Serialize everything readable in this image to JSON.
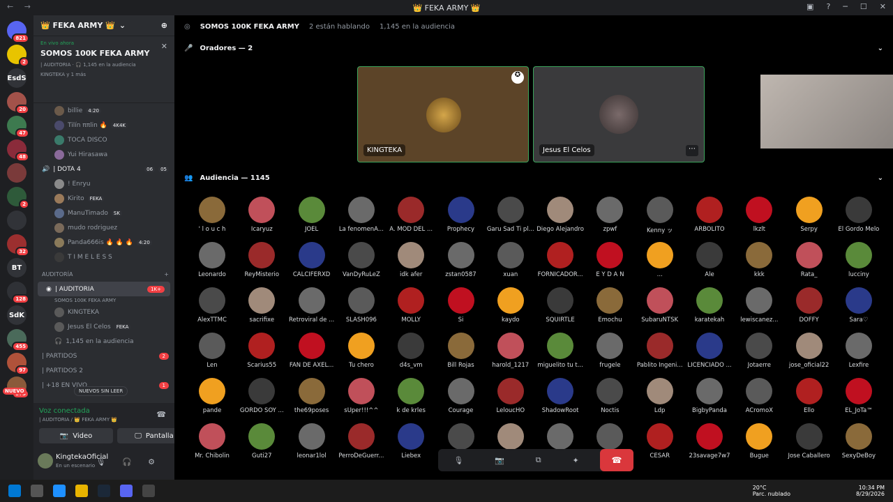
{
  "window": {
    "title": "👑 FEKA ARMY 👑"
  },
  "servers": [
    {
      "label": "",
      "badge": "821",
      "color": "#5865f2"
    },
    {
      "label": "",
      "badge": "2",
      "color": "#e8c400"
    },
    {
      "label": "EsdS",
      "badge": "",
      "color": "#313338"
    },
    {
      "label": "",
      "badge": "20",
      "color": "#a3524a"
    },
    {
      "label": "",
      "badge": "47",
      "color": "#3d7a4f"
    },
    {
      "label": "",
      "badge": "48",
      "color": "#8a2b3a"
    },
    {
      "label": "",
      "badge": "",
      "color": "#7a3a3a"
    },
    {
      "label": "",
      "badge": "2",
      "color": "#2e5a3a"
    },
    {
      "label": "",
      "badge": "",
      "color": "#313338"
    },
    {
      "label": "",
      "badge": "32",
      "color": "#9c2f2f"
    },
    {
      "label": "BT",
      "badge": "",
      "color": "#313338"
    },
    {
      "label": "",
      "badge": "128",
      "color": "#2f3136"
    },
    {
      "label": "SdK",
      "badge": "",
      "color": "#313338"
    },
    {
      "label": "",
      "badge": "455",
      "color": "#4a6a5a"
    },
    {
      "label": "",
      "badge": "97",
      "color": "#b0523a"
    },
    {
      "label": "",
      "badge": "373",
      "color": "#8a5a3a"
    }
  ],
  "new_badge": "NUEVO",
  "sidebar": {
    "server_name": "👑 FEKA ARMY 👑",
    "live_label": "En vivo ahora",
    "stage_title": "SOMOS 100K FEKA ARMY",
    "stage_sub": "| AUDITORIA · 🎧 1,145 en la audiencia",
    "stage_people": "KINGTEKA y 1 más",
    "members_top": [
      {
        "name": "billie",
        "tag": "4:20",
        "color": "#6b5a4a"
      },
      {
        "name": "Tilín ππlin 🔥",
        "tag": "4K4K",
        "color": "#4a4a6b"
      },
      {
        "name": "TOCA DISCO",
        "tag": "",
        "color": "#3a7a6a"
      },
      {
        "name": "Yui Hirasawa",
        "tag": "",
        "color": "#8a6a9a"
      }
    ],
    "dota_channel": "| DOTA 4",
    "dota_count_a": "06",
    "dota_count_b": "05",
    "dota_members": [
      {
        "name": "! Enryu",
        "tag": "",
        "color": "#8a8a8a"
      },
      {
        "name": "Kirito",
        "tag": "FEKA",
        "color": "#9a7a5a"
      },
      {
        "name": "ManuTimado",
        "tag": "SK",
        "color": "#5a6a8a"
      },
      {
        "name": "mudo rodriguez",
        "tag": "",
        "color": "#7a6a5a"
      },
      {
        "name": "Panda666is 🔥 🔥 🔥",
        "tag": "4:20",
        "color": "#8a7a5a"
      },
      {
        "name": "T I M E L E S S",
        "tag": "",
        "color": "#3a3a3a"
      }
    ],
    "category": "AUDITORÍA",
    "auditoria_channel": "| AUDITORIA",
    "auditoria_badge": "1K+",
    "auditoria_sub": "SOMOS 100K FEKA ARMY",
    "auditoria_members": [
      {
        "name": "KINGTEKA",
        "tag": ""
      },
      {
        "name": "Jesus El Celos",
        "tag": "FEKA"
      }
    ],
    "audience_line": "1,145 en la audiencia",
    "other_channels": [
      {
        "name": "| PARTIDOS",
        "badge": "2"
      },
      {
        "name": "| PARTIDOS 2",
        "badge": ""
      },
      {
        "name": "| +18 EN VIVO",
        "badge": "1"
      }
    ],
    "unread_pill": "NUEVOS SIN LEER"
  },
  "voice": {
    "status": "Voz conectada",
    "sub": "| AUDITORIA / 👑 FEKA ARMY 👑",
    "video_label": "Video",
    "screen_label": "Pantalla",
    "user_name": "KingtekaOficial",
    "user_status": "En un escenario"
  },
  "stage": {
    "title": "SOMOS 100K FEKA ARMY",
    "speaking": "2 están hablando",
    "audience": "1,145 en la audiencia",
    "speakers_header": "Oradores — 2",
    "audience_header": "Audiencia — 1145",
    "speakers": [
      {
        "name": "KINGTEKA",
        "bg": "#5c4428"
      },
      {
        "name": "Jesus El Celos",
        "bg": "#3a3a3c"
      }
    ]
  },
  "audience": [
    [
      "' l o u c h",
      "Icaryuz",
      "JOEL",
      "La fenomenA...",
      "A. MOD DEL ...",
      "Prophecy",
      "Garu Sad Ti pl...",
      "Diego Alejandro",
      "zpwf",
      "Kenny ッ",
      "ARBOLITO",
      "lkzlt",
      "Serpy",
      "El Gordo Melo"
    ],
    [
      "Leonardo",
      "ReyMisterio",
      "CALCIFERXD",
      "VanDyRuLeZ",
      "idk afer",
      "zstan0587",
      "xuan",
      "FORNICADOR...",
      "E Y D A N",
      "...",
      "Ale",
      "kkk",
      "Rata_",
      "lucciny"
    ],
    [
      "AlexTTMC",
      "sacrifixe",
      "Retroviral de ...",
      "SLASH096",
      "MOLLY",
      "Si",
      "kaydo",
      "SQUIRTLE",
      "Emochu",
      "SubaruNTSK",
      "karatekah",
      "lewiscanez...",
      "DOFFY",
      "Sara♡"
    ],
    [
      "Len",
      "Scarius55",
      "FAN DE AXEL...",
      "Tu chero",
      "d4s_vm",
      "Bill Rojas",
      "harold_1217",
      "miguelito tu t...",
      "frugele",
      "Pablito Ingeni...",
      "LICENCIADO ...",
      "Jotaerre",
      "jose_oficial22",
      "Lexfire"
    ],
    [
      "pande",
      "GORDO SOY ...",
      "the69poses",
      "sUper!!!^^",
      "k de krles",
      "Courage",
      "LeloucHO",
      "ShadowRoot",
      "Noctis",
      "Ldp",
      "BigbyPanda",
      "ACromoX",
      "Ello",
      "EL_JoTa™"
    ],
    [
      "Mr. Chibolin",
      "Guti27",
      "leonar1lol",
      "PerroDeGuerr...",
      "Liebex",
      "",
      "",
      "",
      "",
      "CESAR",
      "23savage7w7",
      "Bugue",
      "Jose Caballero",
      "SexyDeBoy"
    ]
  ],
  "avatar_colors": [
    "#8a6a3a",
    "#c0505a",
    "#5a8a3a",
    "#6a6a6a",
    "#9a2a2a",
    "#2a3a8a",
    "#4a4a4a",
    "#a08a7a",
    "#6a6a6a",
    "#5a5a5a",
    "#b02020",
    "#c01020",
    "#f0a020",
    "#3a3a3a"
  ],
  "taskbar": {
    "weather_temp": "20°C",
    "weather_desc": "Parc. nublado",
    "time": "10:34 PM",
    "date": "8/29/2026"
  }
}
